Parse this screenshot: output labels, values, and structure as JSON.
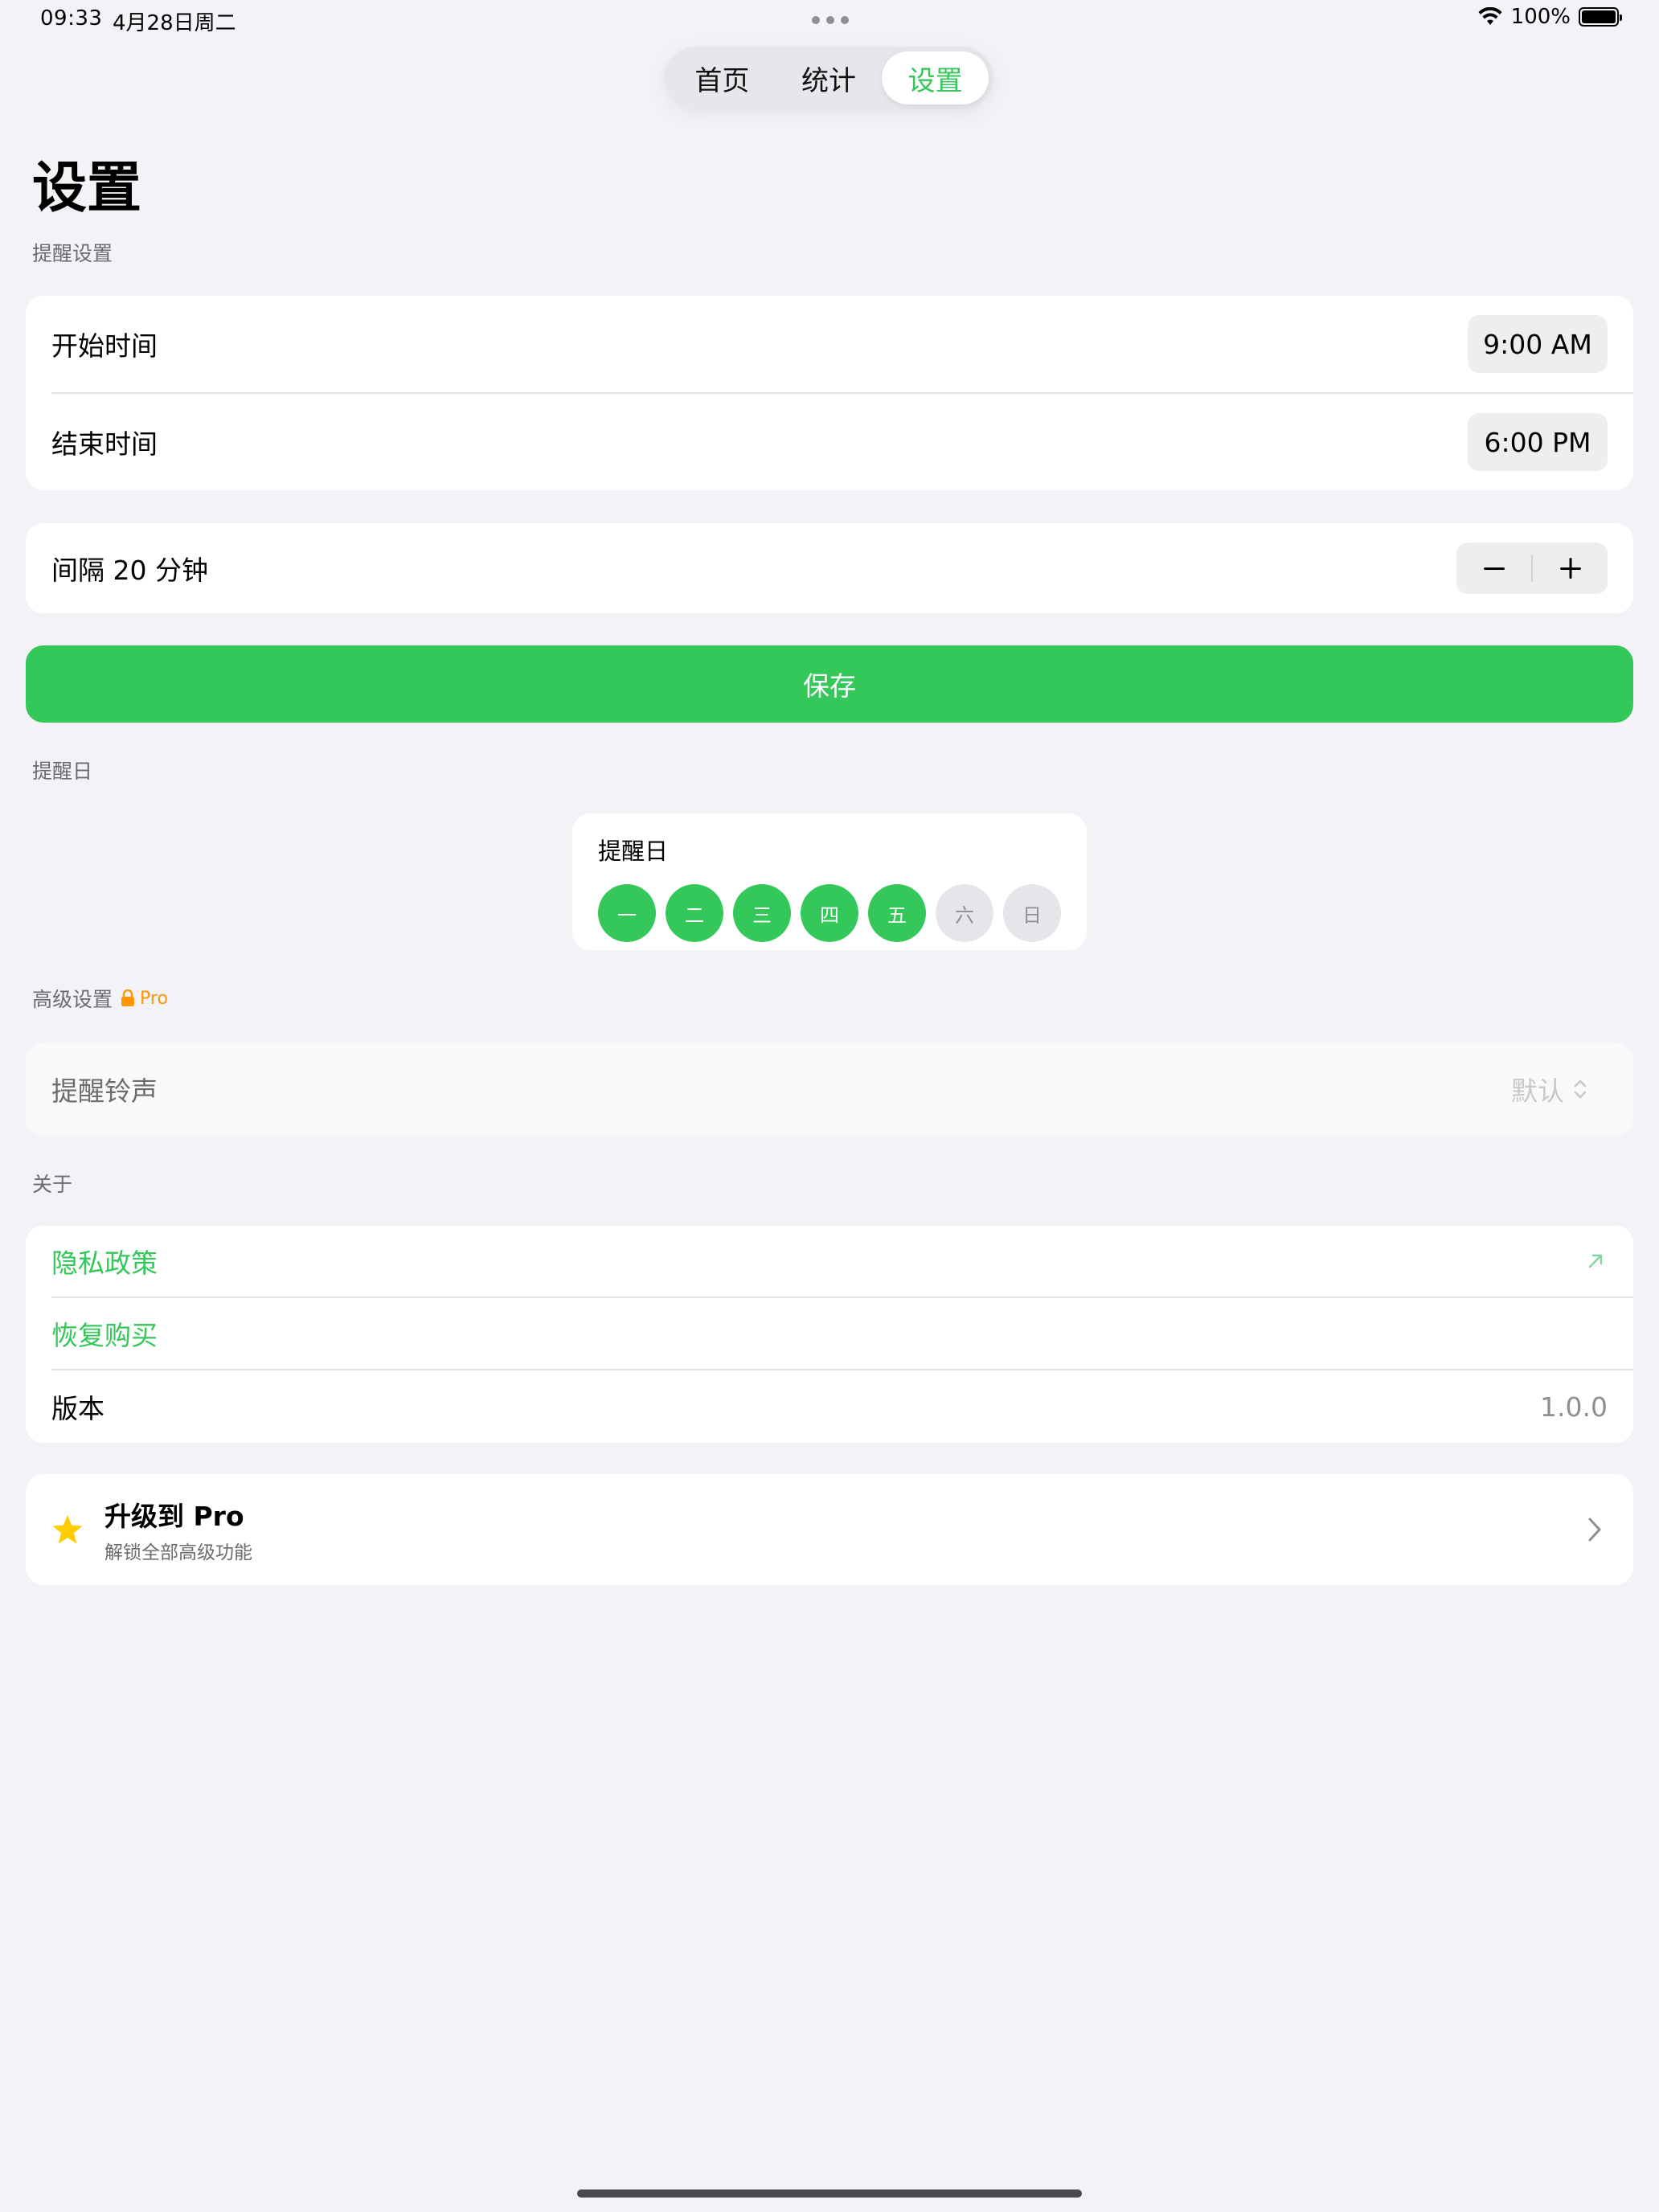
{
  "status_bar": {
    "time": "09:33",
    "date": "4月28日周二",
    "battery": "100%"
  },
  "tabs": [
    {
      "label": "首页",
      "active": false
    },
    {
      "label": "统计",
      "active": false
    },
    {
      "label": "设置",
      "active": true
    }
  ],
  "page_title": "设置",
  "reminder_settings": {
    "section_label": "提醒设置",
    "start_label": "开始时间",
    "start_value": "9:00 AM",
    "end_label": "结束时间",
    "end_value": "6:00 PM",
    "interval_label": "间隔 20 分钟"
  },
  "save_label": "保存",
  "reminder_days": {
    "section_label": "提醒日",
    "card_title": "提醒日",
    "days": [
      {
        "label": "一",
        "on": true
      },
      {
        "label": "二",
        "on": true
      },
      {
        "label": "三",
        "on": true
      },
      {
        "label": "四",
        "on": true
      },
      {
        "label": "五",
        "on": true
      },
      {
        "label": "六",
        "on": false
      },
      {
        "label": "日",
        "on": false
      }
    ]
  },
  "advanced": {
    "section_label": "高级设置",
    "pro_tag": "Pro",
    "sound_label": "提醒铃声",
    "sound_value": "默认"
  },
  "about": {
    "section_label": "关于",
    "privacy_label": "隐私政策",
    "restore_label": "恢复购买",
    "version_label": "版本",
    "version_value": "1.0.0"
  },
  "upgrade": {
    "title": "升级到 Pro",
    "subtitle": "解锁全部高级功能"
  },
  "colors": {
    "accent": "#34C759",
    "pro": "#FF9500",
    "star": "#FFCC00",
    "background": "#F2F2F7"
  }
}
